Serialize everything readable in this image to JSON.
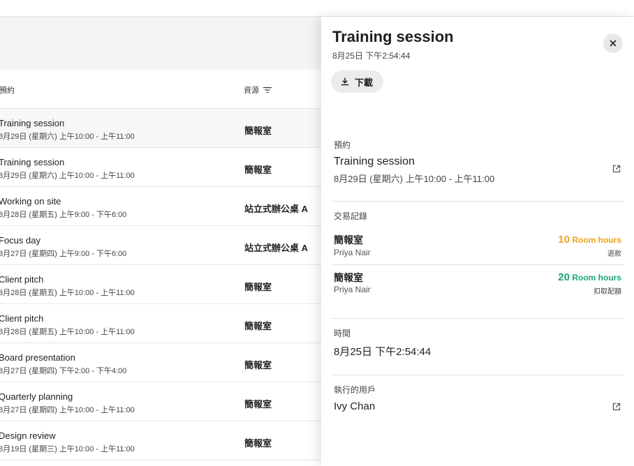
{
  "table": {
    "headers": {
      "booking": "預約",
      "resource": "資源"
    },
    "rows": [
      {
        "title": "Training session",
        "time": "8月29日 (星期六) 上午10:00 - 上午11:00",
        "resource": "簡報室"
      },
      {
        "title": "Training session",
        "time": "8月29日 (星期六) 上午10:00 - 上午11:00",
        "resource": "簡報室"
      },
      {
        "title": "Working on site",
        "time": "8月28日 (星期五) 上午9:00 - 下午6:00",
        "resource": "站立式辦公桌 A"
      },
      {
        "title": "Focus day",
        "time": "8月27日 (星期四) 上午9:00 - 下午6:00",
        "resource": "站立式辦公桌 A"
      },
      {
        "title": "Client pitch",
        "time": "8月28日 (星期五) 上午10:00 - 上午11:00",
        "resource": "簡報室"
      },
      {
        "title": "Client pitch",
        "time": "8月28日 (星期五) 上午10:00 - 上午11:00",
        "resource": "簡報室"
      },
      {
        "title": "Board presentation",
        "time": "8月27日 (星期四) 下午2:00 - 下午4:00",
        "resource": "簡報室"
      },
      {
        "title": "Quarterly planning",
        "time": "8月27日 (星期四) 上午10:00 - 上午11:00",
        "resource": "簡報室"
      },
      {
        "title": "Design review",
        "time": "8月19日 (星期三) 上午10:00 - 上午11:00",
        "resource": "簡報室"
      }
    ]
  },
  "panel": {
    "title": "Training session",
    "timestamp": "8月25日 下午2:54:44",
    "download_label": "下載",
    "booking_section": {
      "label": "預約",
      "title": "Training session",
      "time": "8月29日 (星期六) 上午10:00 - 上午11:00"
    },
    "transactions_section": {
      "label": "交易記錄",
      "items": [
        {
          "resource": "簡報室",
          "user": "Priya Nair",
          "amount": "10",
          "unit": "Room hours",
          "type": "退款",
          "color": "#f0a21c"
        },
        {
          "resource": "簡報室",
          "user": "Priya Nair",
          "amount": "20",
          "unit": "Room hours",
          "type": "扣取配額",
          "color": "#1aa37a"
        }
      ]
    },
    "time_section": {
      "label": "時間",
      "value": "8月25日 下午2:54:44"
    },
    "user_section": {
      "label": "執行的用戶",
      "value": "Ivy Chan"
    }
  },
  "colors": {
    "refund": "#f0a21c",
    "deduct": "#1aa37a"
  },
  "icons": [
    "filter-icon",
    "close-icon",
    "download-icon",
    "external-link-icon"
  ]
}
